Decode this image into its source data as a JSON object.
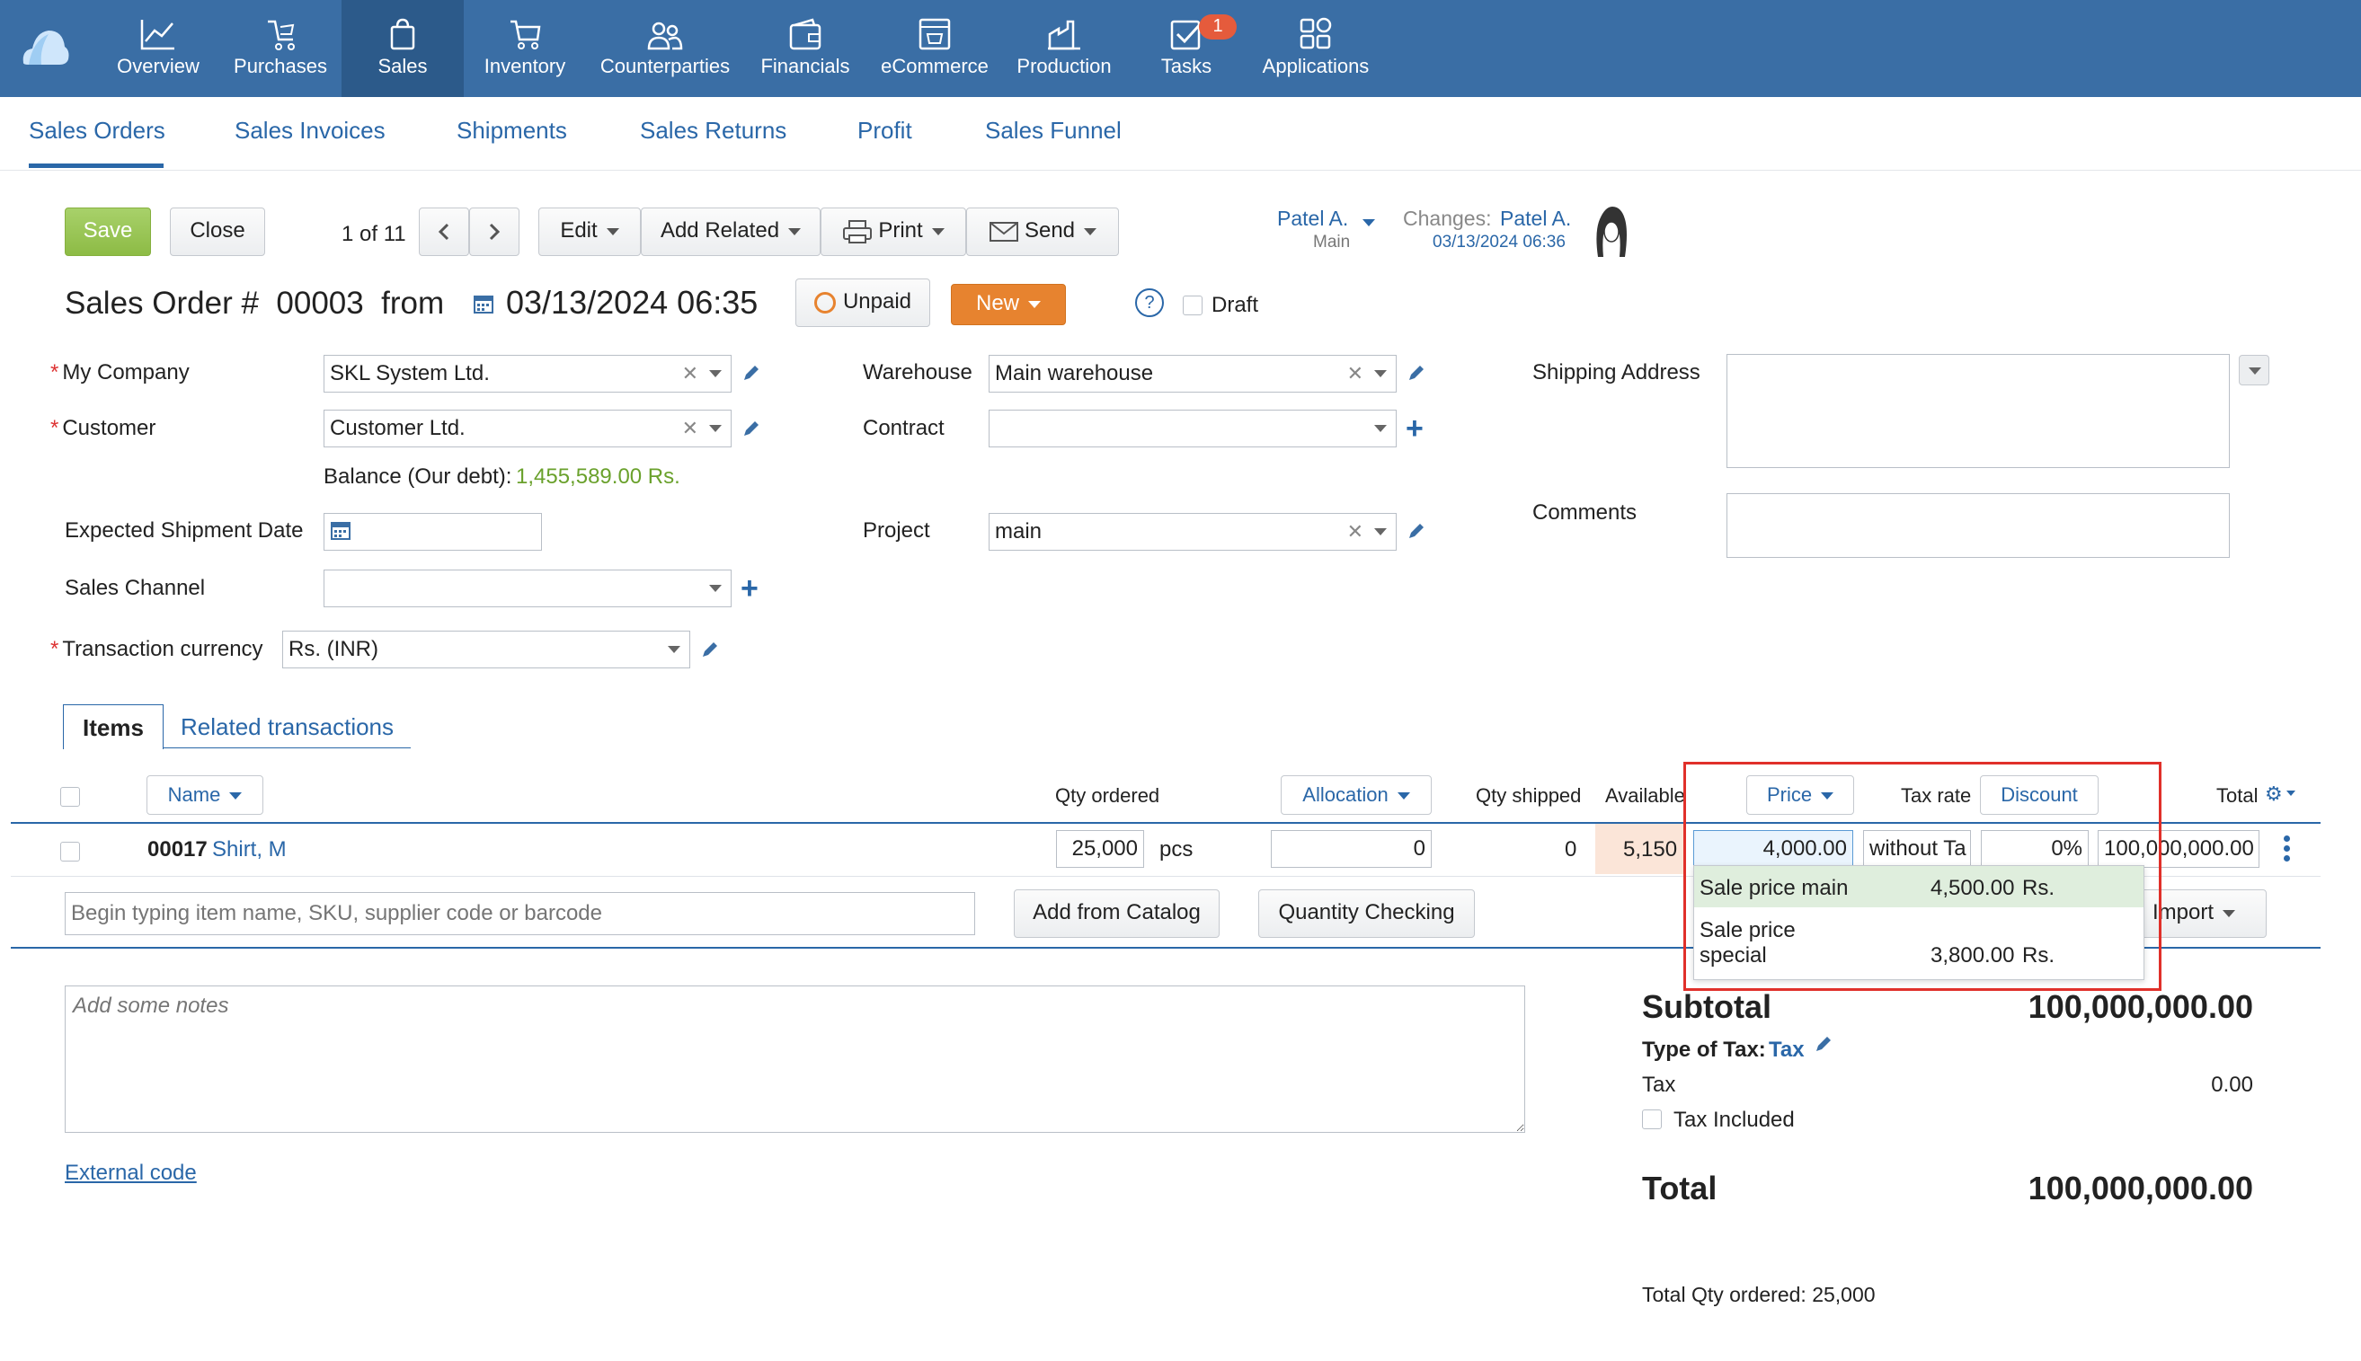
{
  "nav": {
    "items": [
      {
        "label": "Overview",
        "icon": "chart-line-icon"
      },
      {
        "label": "Purchases",
        "icon": "cart-hand-icon"
      },
      {
        "label": "Sales",
        "icon": "shopping-bag-icon"
      },
      {
        "label": "Inventory",
        "icon": "shopping-cart-icon"
      },
      {
        "label": "Counterparties",
        "icon": "people-icon"
      },
      {
        "label": "Financials",
        "icon": "wallet-icon"
      },
      {
        "label": "eCommerce",
        "icon": "storefront-icon"
      },
      {
        "label": "Production",
        "icon": "factory-icon"
      },
      {
        "label": "Tasks",
        "icon": "checkbox-icon"
      },
      {
        "label": "Applications",
        "icon": "apps-grid-icon"
      }
    ],
    "active": "Sales",
    "tasks_badge": "1"
  },
  "subnav": {
    "tabs": [
      "Sales Orders",
      "Sales Invoices",
      "Shipments",
      "Sales Returns",
      "Profit",
      "Sales Funnel"
    ],
    "active": "Sales Orders"
  },
  "toolbar": {
    "save": "Save",
    "close": "Close",
    "pager": "1 of 11",
    "edit": "Edit",
    "add_related": "Add Related",
    "print": "Print",
    "send": "Send"
  },
  "owner": {
    "name": "Patel A.",
    "group": "Main",
    "changes_label": "Changes:",
    "changes_user": "Patel A.",
    "changes_date": "03/13/2024 06:36"
  },
  "order": {
    "title_prefix": "Sales Order #",
    "number": "00003",
    "from": "from",
    "datetime": "03/13/2024 06:35",
    "payment_status": "Unpaid",
    "status": "New",
    "help": "?",
    "draft_label": "Draft"
  },
  "form": {
    "my_company_label": "My Company",
    "my_company": "SKL System Ltd.",
    "customer_label": "Customer",
    "customer": "Customer Ltd.",
    "balance_label": "Balance (Our debt):",
    "balance_value": "1,455,589.00 Rs.",
    "expected_shipment_label": "Expected Shipment Date",
    "expected_shipment": "",
    "sales_channel_label": "Sales Channel",
    "sales_channel": "",
    "currency_label": "Transaction currency",
    "currency": "Rs. (INR)",
    "warehouse_label": "Warehouse",
    "warehouse": "Main warehouse",
    "contract_label": "Contract",
    "contract": "",
    "project_label": "Project",
    "project": "main",
    "shipping_label": "Shipping Address",
    "comments_label": "Comments"
  },
  "tabs": {
    "items": "Items",
    "related": "Related transactions"
  },
  "table": {
    "headers": {
      "name": "Name",
      "qty_ordered": "Qty ordered",
      "allocation": "Allocation",
      "qty_shipped": "Qty shipped",
      "available": "Available",
      "price": "Price",
      "tax_rate": "Tax rate",
      "discount": "Discount",
      "total": "Total"
    },
    "row": {
      "code": "00017",
      "name": "Shirt, M",
      "qty": "25,000",
      "unit": "pcs",
      "allocation": "0",
      "shipped": "0",
      "available": "5,150",
      "price": "4,000.00",
      "tax": "without Ta",
      "discount": "0%",
      "total": "100,000,000.00"
    },
    "search_placeholder": "Begin typing item name, SKU, supplier code or barcode",
    "add_from_catalog": "Add from Catalog",
    "quantity_checking": "Quantity Checking",
    "import": "Import"
  },
  "price_dropdown": {
    "options": [
      {
        "name": "Sale price main",
        "value": "4,500.00",
        "currency": "Rs."
      },
      {
        "name_line1": "Sale price",
        "name_line2": "special",
        "value": "3,800.00",
        "currency": "Rs."
      }
    ]
  },
  "notes_placeholder": "Add some notes",
  "external_code": "External code",
  "summary": {
    "subtotal_label": "Subtotal",
    "subtotal": "100,000,000.00",
    "type_of_tax_label": "Type of Tax:",
    "type_of_tax": "Tax",
    "tax_label": "Tax",
    "tax": "0.00",
    "tax_included_label": "Tax Included",
    "total_label": "Total",
    "total": "100,000,000.00",
    "total_qty": "Total Qty ordered: 25,000"
  },
  "colors": {
    "nav_bg": "#3a6ea5",
    "link": "#2a67a8",
    "save_green": "#8dbb45",
    "new_orange": "#e7832f",
    "balance_green": "#6aa12c",
    "highlight_red": "#e0302a"
  }
}
